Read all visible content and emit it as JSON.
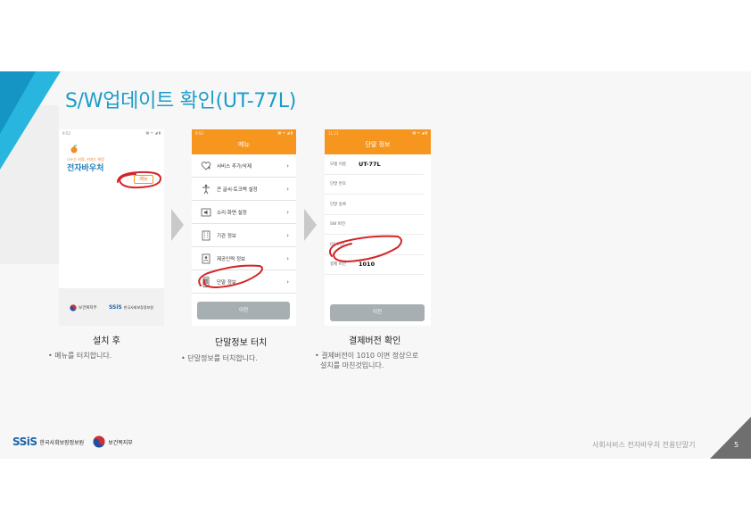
{
  "slide": {
    "title": "S/W업데이트 확인(UT-77L)",
    "page_number": "5",
    "footer_text": "사회서비스 전자바우처 전용단말기",
    "accent_color": "#1b9cc9",
    "orange_color": "#f7961e"
  },
  "logos": {
    "ssis_mark": "SSiS",
    "ssis_org": "한국사회보장정보원",
    "mohw": "보건복지부"
  },
  "phone1": {
    "statusbar_time": "9:52",
    "statusbar_icons": "▦ ᯤ ◢ ▮",
    "slogan": "나누는 사랑, 커지는 희망",
    "app_name": "전자바우처",
    "menu_button": "메뉴",
    "footer_mohw": "보건복지부",
    "footer_ssis_mark": "SSiS",
    "footer_ssis_org": "한국사회보장정보원"
  },
  "phone2": {
    "statusbar_time": "9:52",
    "statusbar_icons": "▦ ᯤ ◢ ▮",
    "header_title": "메뉴",
    "menu_items": [
      {
        "label": "서비스 추가/삭제",
        "icon": "heart-plus-icon"
      },
      {
        "label": "큰 글씨·토크백 설정",
        "icon": "accessibility-icon"
      },
      {
        "label": "소리·화면 설정",
        "icon": "speaker-screen-icon"
      },
      {
        "label": "기관 정보",
        "icon": "building-icon"
      },
      {
        "label": "제공인력 정보",
        "icon": "person-doc-icon"
      },
      {
        "label": "단말 정보",
        "icon": "device-icon"
      }
    ],
    "chevron": "›",
    "prev_button": "이전"
  },
  "phone3": {
    "statusbar_time": "11:21",
    "statusbar_icons": "▦ ᯤ ◢ ▮",
    "header_title": "단말 정보",
    "rows": [
      {
        "key": "모델 이름",
        "value": "UT-77L"
      },
      {
        "key": "단말 번호",
        "value": ""
      },
      {
        "key": "단말 등록",
        "value": ""
      },
      {
        "key": "SW 버전",
        "value": ""
      },
      {
        "key": "OS 버전",
        "value": ""
      },
      {
        "key": "결제 버전",
        "value": "1010"
      }
    ],
    "prev_button": "이전"
  },
  "captions": [
    {
      "title": "설치 후",
      "text": "• 메뉴를 터치합니다."
    },
    {
      "title": "단말정보 터치",
      "text": "• 단말정보를 터치합니다."
    },
    {
      "title": "결제버전 확인",
      "text": "• 결제버전이 1010 이면 정상으로",
      "text2": "설치를 마친것입니다."
    }
  ]
}
